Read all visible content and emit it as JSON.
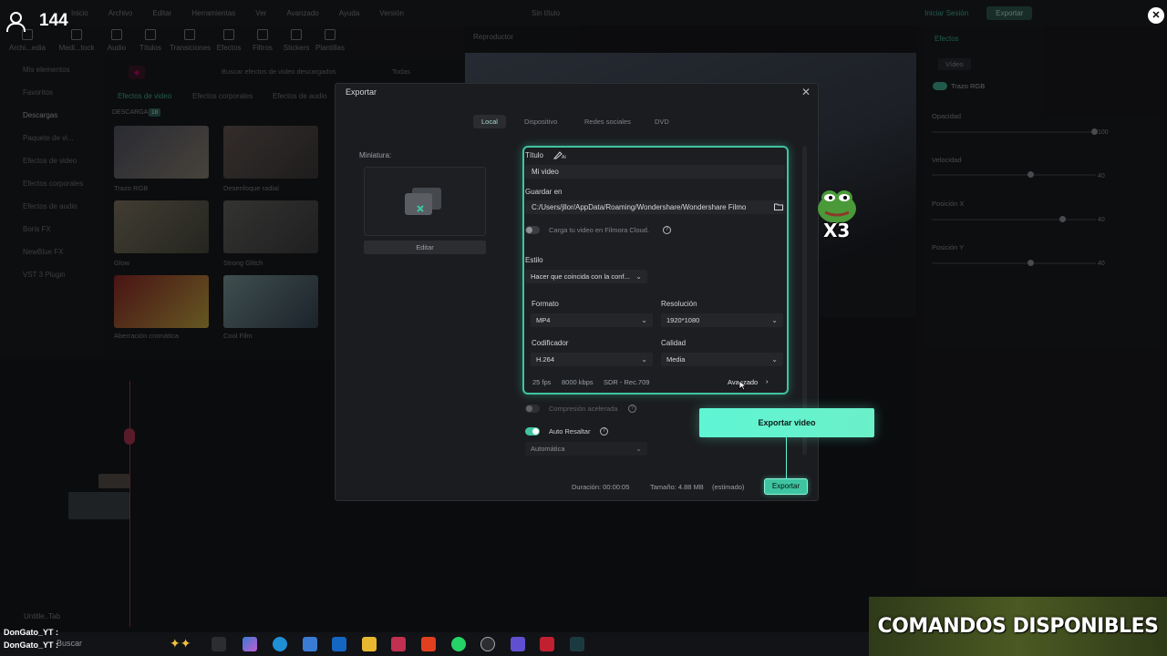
{
  "app": {
    "menu": [
      "Inicio",
      "Archivo",
      "Editar",
      "Herramientas",
      "Ver",
      "Avanzado",
      "Ayuda",
      "Versión"
    ],
    "title": "Sin título",
    "login": "Iniciar Sesión",
    "export_top": "Exportar",
    "toolbar": [
      "Archi...edia",
      "Medi...tock",
      "Audio",
      "Títulos",
      "Transiciones",
      "Efectos",
      "Filtros",
      "Stickers",
      "Plantillas"
    ],
    "left_panel": [
      "Mis elementos",
      "Favoritos",
      "Descargas",
      "Paquete de vi...",
      "Efectos de video",
      "Efectos corporales",
      "Efectos de audio",
      "Boris FX",
      "NewBlue FX",
      "VST 3 Plugin"
    ],
    "media_filter": "Todas",
    "media_search": "Buscar efectos de vídeo descargados",
    "media_tabs": [
      "Efectos de video",
      "Efectos corporales",
      "Efectos de audio"
    ],
    "downloads_label": "DESCARGAS",
    "downloads_count": "18",
    "thumbs": [
      "Trazo RGB",
      "Desenfoque radial",
      "Glow",
      "Strong Glitch",
      "Aberración cromática",
      "Cool Film"
    ],
    "player_label": "Reproductor",
    "right_tabs": [
      "Efectos",
      "Vídeo"
    ],
    "right_effect": "Trazo RGB",
    "right_props": [
      "Opacidad",
      "Velocidad",
      "Posición X",
      "Posición Y"
    ],
    "right_values": [
      "100",
      "40",
      "40",
      "40"
    ],
    "track_label": "Untitle..Tab"
  },
  "dialog": {
    "title": "Exportar",
    "close": "✕",
    "tabs": [
      "Local",
      "Dispositivo",
      "Redes sociales",
      "DVD"
    ],
    "thumbnail_label": "Miniatura:",
    "edit_button": "Editar",
    "title_label": "Título",
    "title_value": "Mi video",
    "save_label": "Guardar en",
    "save_path": "C:/Users/jllor/AppData/Roaming/Wondershare/Wondershare Filmo",
    "cloud_upload": "Carga tu video en Filmora Cloud.",
    "style_label": "Estilo",
    "style_value": "Hacer que coincida con la conf...",
    "format_label": "Formato",
    "format_value": "MP4",
    "resolution_label": "Resolución",
    "resolution_value": "1920*1080",
    "encoder_label": "Codificador",
    "encoder_value": "H.264",
    "quality_label": "Calidad",
    "quality_value": "Media",
    "fps": "25 fps",
    "bitrate": "8000 kbps",
    "colorspace": "SDR - Rec.709",
    "advanced": "Avanzado",
    "accel_compression": "Compresión acelerada",
    "auto_highlight": "Auto Resaltar",
    "auto_value": "Automática",
    "duration": "Duración: 00:00:05",
    "size": "Tamaño: 4.88 MB",
    "estimated": "(estimado)",
    "export_button": "Exportar"
  },
  "overlay": {
    "viewers": "144",
    "emote_text": "X3",
    "callout": "Exportar video",
    "commands_banner": "COMANDOS DISPONIBLES",
    "chat": [
      "DonGato_YT :",
      "DonGato_YT :"
    ],
    "search": "Buscar"
  },
  "colors": {
    "accent": "#3fc4a2",
    "callout": "#5ff5d4",
    "dialog_bg": "#1b1c1f"
  }
}
